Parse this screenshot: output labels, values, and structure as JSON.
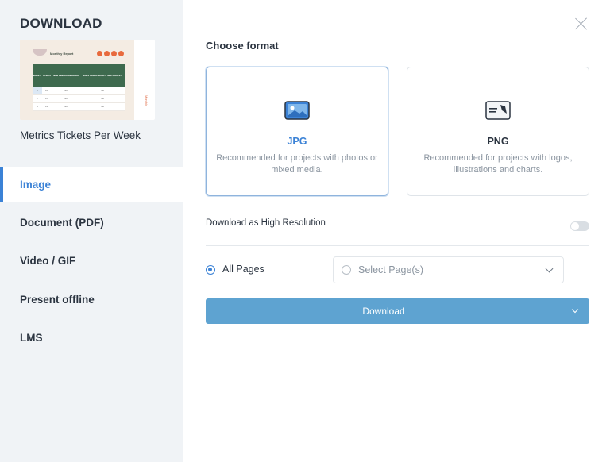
{
  "sidebar": {
    "title": "DOWNLOAD",
    "document_name": "Metrics Tickets Per Week",
    "thumbnail": {
      "heading": "Monthly Report",
      "columns": [
        "Week #",
        "Tickets",
        "New Feature Released",
        "Were tickets about a new feature?"
      ],
      "rows": [
        [
          "1",
          "20",
          "No",
          "No"
        ],
        [
          "2",
          "25",
          "No",
          "No"
        ],
        [
          "3",
          "23",
          "No",
          "No"
        ]
      ],
      "side_text": "Monthly"
    },
    "nav_items": [
      {
        "label": "Image",
        "active": true
      },
      {
        "label": "Document (PDF)",
        "active": false
      },
      {
        "label": "Video / GIF",
        "active": false
      },
      {
        "label": "Present offline",
        "active": false
      },
      {
        "label": "LMS",
        "active": false
      }
    ]
  },
  "main": {
    "choose_format_label": "Choose format",
    "formats": [
      {
        "name": "JPG",
        "description": "Recommended for projects with photos or mixed media.",
        "selected": true,
        "icon": "image-icon"
      },
      {
        "name": "PNG",
        "description": "Recommended for projects with logos, illustrations and charts.",
        "selected": false,
        "icon": "document-icon"
      }
    ],
    "high_res_label": "Download as High Resolution",
    "high_res_enabled": false,
    "all_pages_label": "All Pages",
    "select_pages_placeholder": "Select Page(s)",
    "download_label": "Download"
  },
  "colors": {
    "accent": "#3b82d6",
    "download_button": "#5ea3d1",
    "sidebar_bg": "#f0f3f6"
  }
}
